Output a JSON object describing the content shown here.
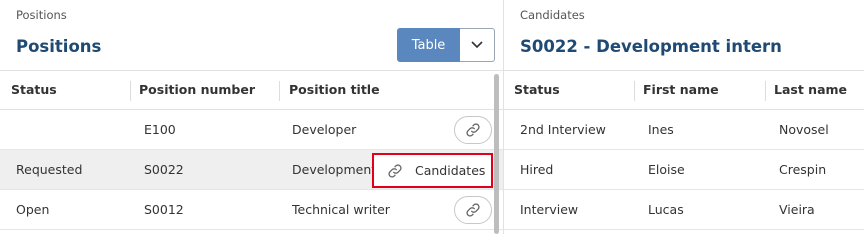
{
  "positions": {
    "breadcrumb": "Positions",
    "title": "Positions",
    "view_button_label": "Table",
    "columns": [
      "Status",
      "Position number",
      "Position title"
    ],
    "rows": [
      {
        "status": "",
        "number": "E100",
        "title": "Developer"
      },
      {
        "status": "Requested",
        "number": "S0022",
        "title": "Development intern",
        "selected": true,
        "action_label": "Candidates"
      },
      {
        "status": "Open",
        "number": "S0012",
        "title": "Technical writer"
      }
    ]
  },
  "candidates": {
    "breadcrumb": "Candidates",
    "title": "S0022 - Development intern",
    "columns": [
      "Status",
      "First name",
      "Last name"
    ],
    "rows": [
      {
        "status": "2nd Interview",
        "first": "Ines",
        "last": "Novosel"
      },
      {
        "status": "Hired",
        "first": "Eloise",
        "last": "Crespin"
      },
      {
        "status": "Interview",
        "first": "Lucas",
        "last": "Vieira"
      }
    ]
  },
  "colors": {
    "accent": "#5b87bf",
    "title": "#1f4a73",
    "highlight": "#e0001b",
    "selected_row": "#efefef"
  },
  "icons": [
    "chevron-down-icon",
    "link-icon"
  ]
}
